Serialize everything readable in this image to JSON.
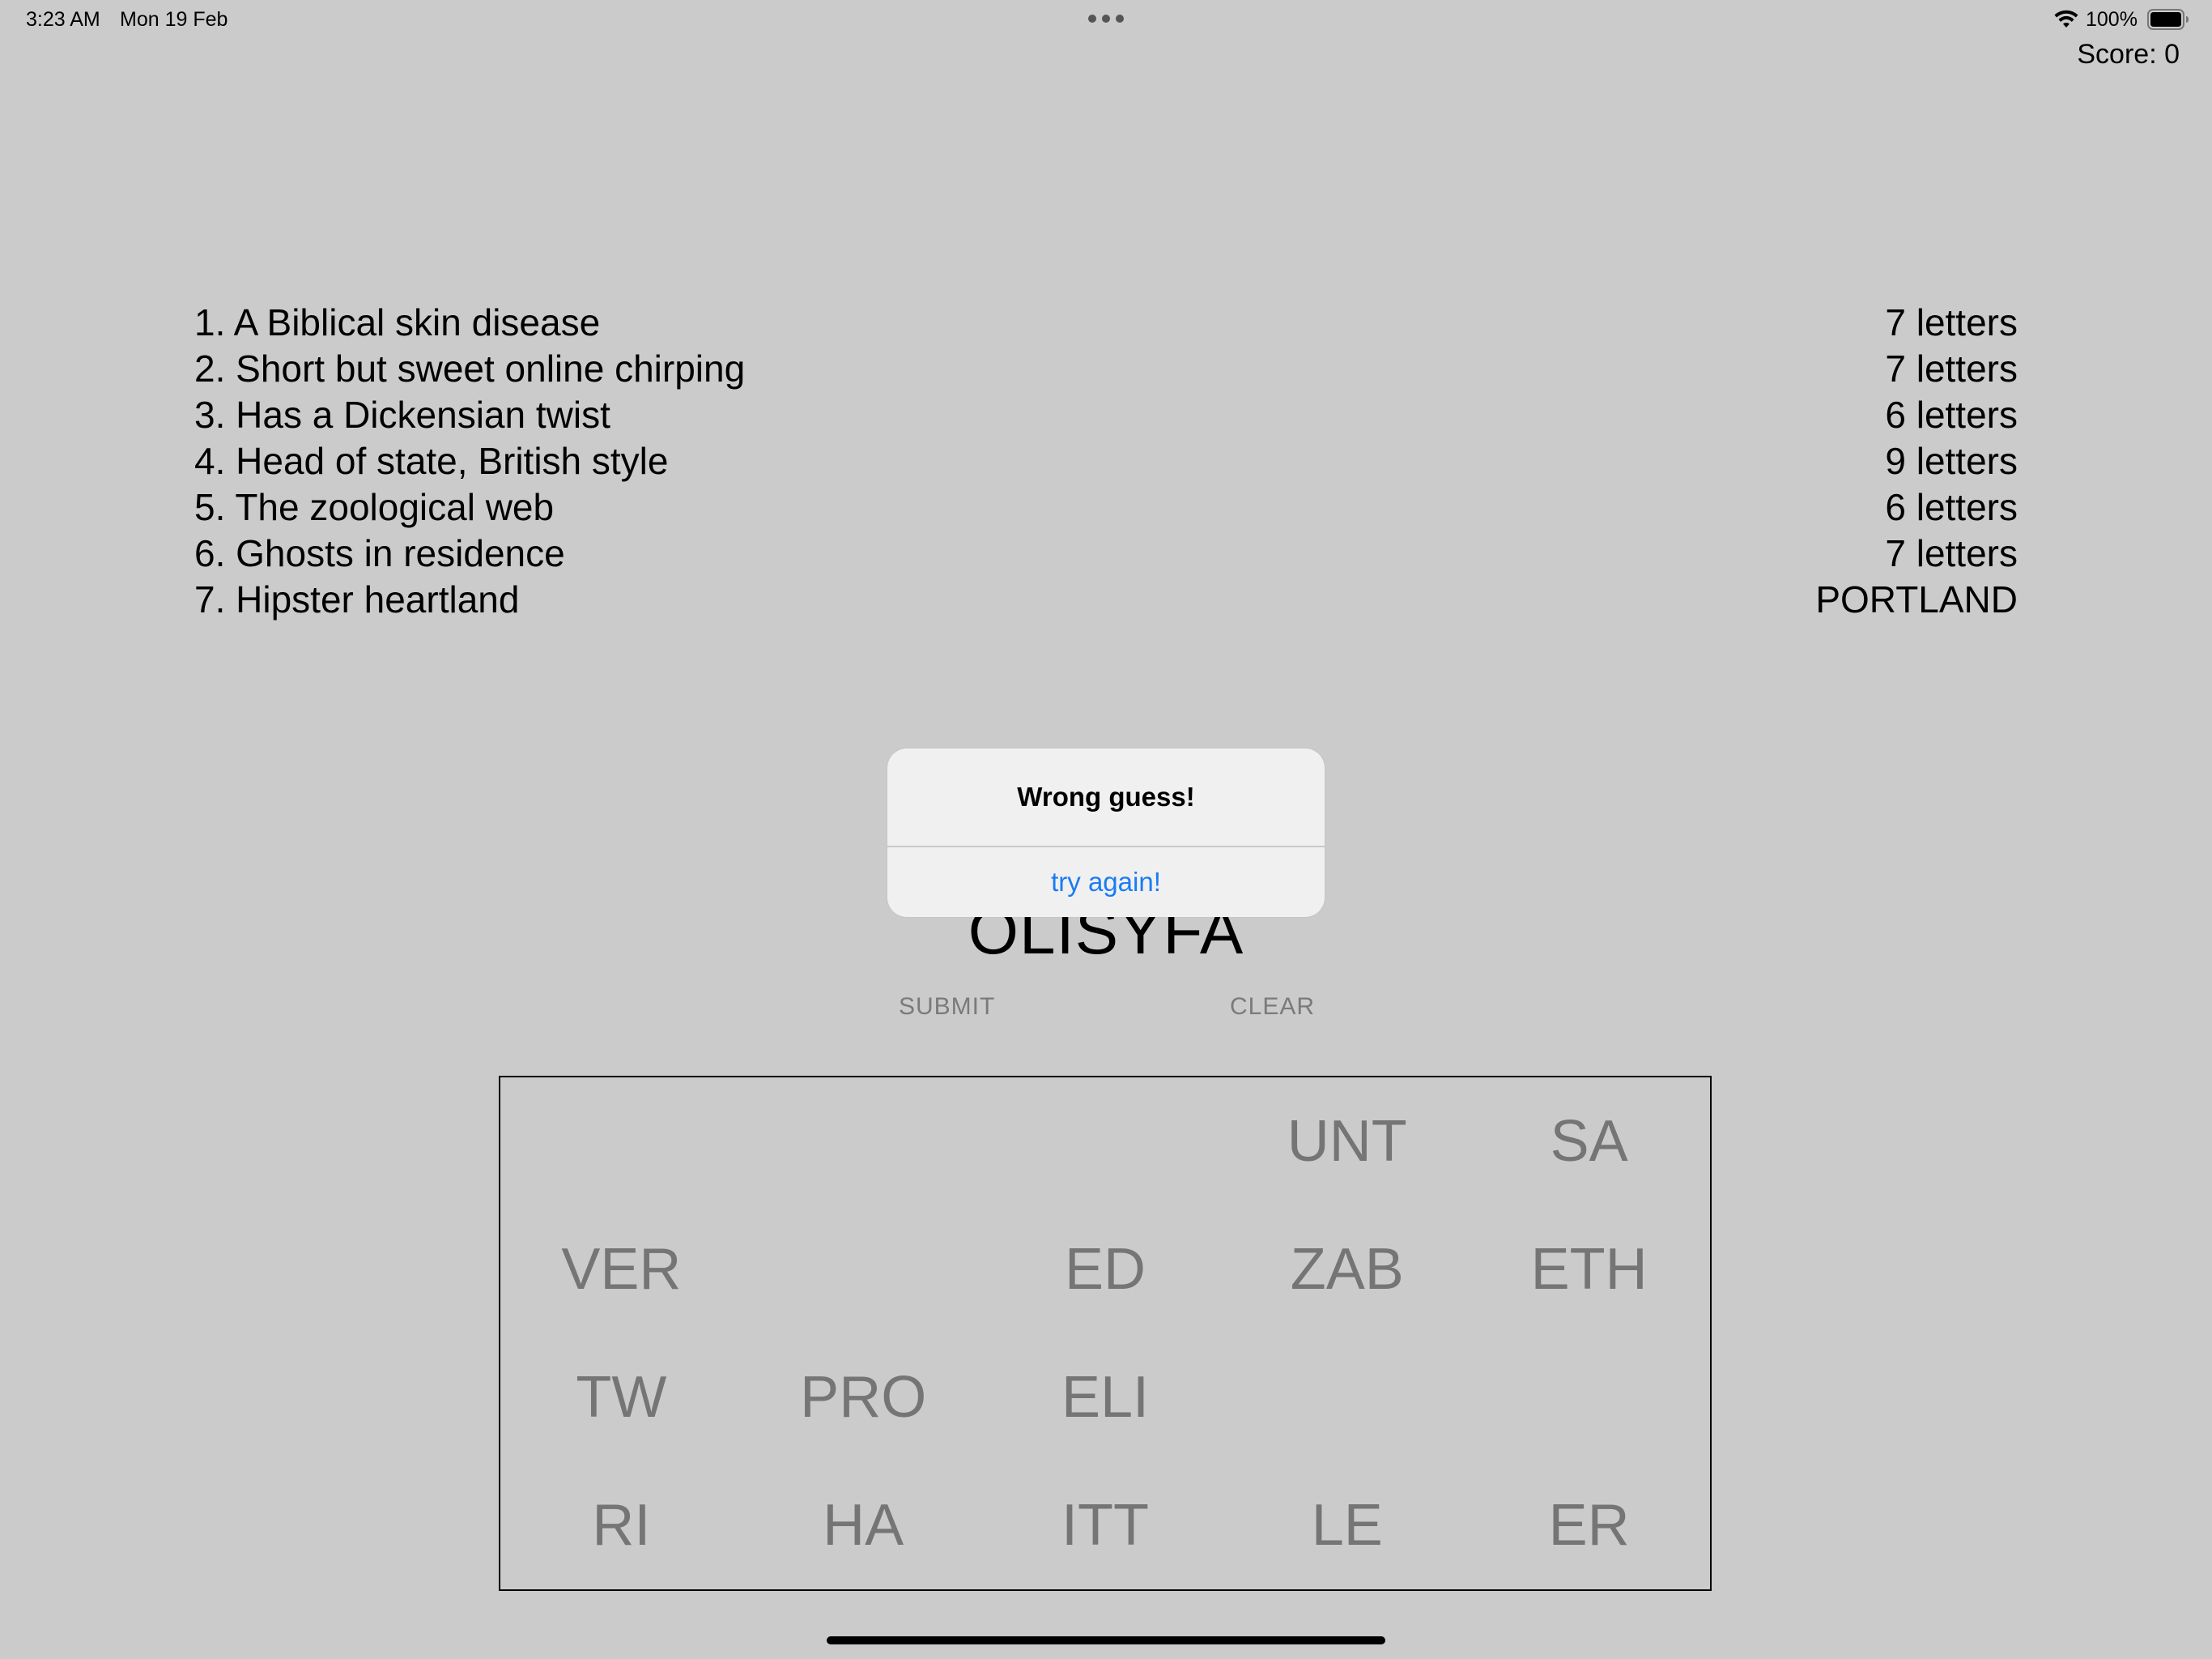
{
  "status_bar": {
    "time": "3:23 AM",
    "date": "Mon 19 Feb",
    "battery_percent": "100%",
    "battery_level": 1.0,
    "icons": [
      "multitasking-dots-icon",
      "wifi-icon",
      "battery-icon"
    ]
  },
  "score_label": "Score: 0",
  "clues": [
    {
      "text": "1. A Biblical skin disease",
      "answer": "7 letters"
    },
    {
      "text": "2. Short but sweet online chirping",
      "answer": "7 letters"
    },
    {
      "text": "3. Has a Dickensian twist",
      "answer": "6 letters"
    },
    {
      "text": "4. Head of state, British style",
      "answer": "9 letters"
    },
    {
      "text": "5. The zoological web",
      "answer": "6 letters"
    },
    {
      "text": "6. Ghosts in residence",
      "answer": "7 letters"
    },
    {
      "text": "7. Hipster heartland",
      "answer": "PORTLAND"
    }
  ],
  "current_word": "OLISYFA",
  "buttons": {
    "submit": "SUBMIT",
    "clear": "CLEAR"
  },
  "tiles": [
    [
      "",
      "",
      "",
      "UNT",
      "SA"
    ],
    [
      "VER",
      "",
      "ED",
      "ZAB",
      "ETH"
    ],
    [
      "TW",
      "PRO",
      "ELI",
      "",
      ""
    ],
    [
      "RI",
      "HA",
      "ITT",
      "LE",
      "ER"
    ]
  ],
  "alert": {
    "title": "Wrong guess!",
    "button": "try again!"
  },
  "colors": {
    "background": "#cbcbcb",
    "alert_button": "#1a7cf2",
    "tile_text": "#757575"
  }
}
